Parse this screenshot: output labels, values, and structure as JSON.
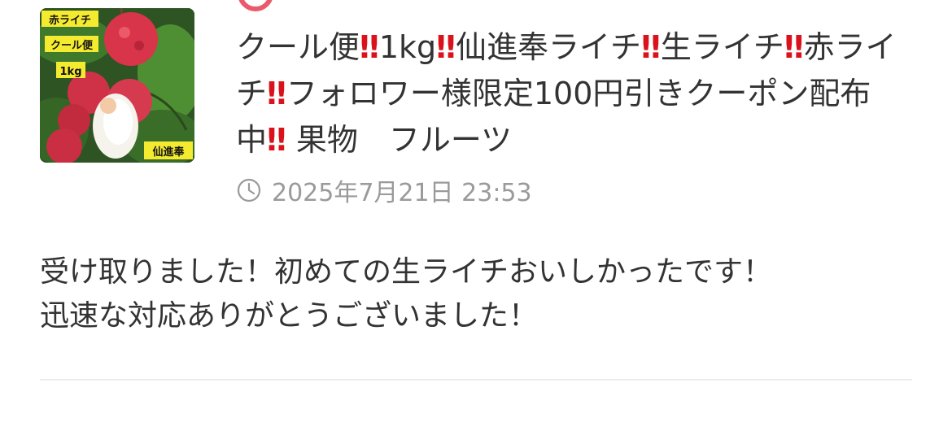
{
  "colors": {
    "text": "#333333",
    "muted": "#9a9a9a",
    "exclamation": "#d9121c",
    "accent": "#ea5a6c",
    "divider": "#ececec"
  },
  "thumbnail": {
    "label_red_lychee": "赤ライチ",
    "label_cool": "クール便",
    "label_weight": "1kg",
    "label_variety": "仙進奉"
  },
  "product": {
    "title_segments": [
      {
        "text": "クール便",
        "type": "text"
      },
      {
        "text": "‼",
        "type": "bang"
      },
      {
        "text": "1kg",
        "type": "text"
      },
      {
        "text": "‼",
        "type": "bang"
      },
      {
        "text": "仙進奉ライチ",
        "type": "text"
      },
      {
        "text": "‼",
        "type": "bang"
      },
      {
        "text": "生ライチ",
        "type": "text"
      },
      {
        "text": "‼",
        "type": "bang"
      },
      {
        "text": "赤ライチ",
        "type": "text"
      },
      {
        "text": "‼",
        "type": "bang"
      },
      {
        "text": "フォロワー様限定100円引きクーポン配布中",
        "type": "text"
      },
      {
        "text": "‼",
        "type": "bang"
      },
      {
        "text": " 果物　フルーツ",
        "type": "text"
      }
    ]
  },
  "meta": {
    "clock_icon": "clock-icon",
    "date": "2025年7月21日 23:53"
  },
  "review": {
    "line1": "受け取りました！初めての生ライチおいしかったです！",
    "line2": "迅速な対応ありがとうございました！"
  }
}
